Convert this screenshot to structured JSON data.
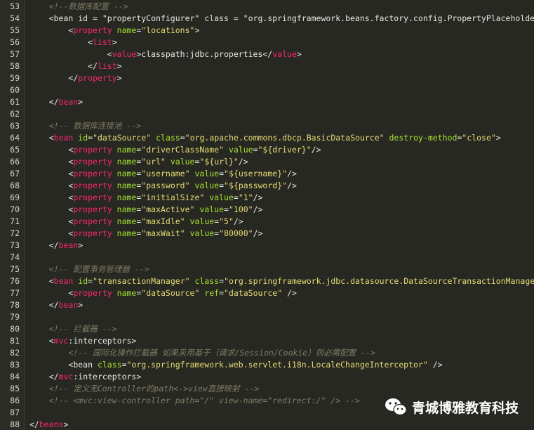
{
  "editor": {
    "lines": [
      {
        "n": "53",
        "tokens": [
          {
            "k": "ws",
            "v": "    "
          },
          {
            "k": "cmt",
            "v": "<!--数据库配置 -->"
          }
        ]
      },
      {
        "n": "54",
        "tokens": [
          {
            "k": "ws",
            "v": "    "
          },
          {
            "k": "punc",
            "v": "<bean id = "
          },
          {
            "k": "t",
            "v": "\"propertyConfigurer\""
          },
          {
            "k": "punc",
            "v": " class = "
          },
          {
            "k": "t",
            "v": "\"org.springframework.beans.factory.config.PropertyPlaceholderCon"
          }
        ]
      },
      {
        "n": "55",
        "tokens": [
          {
            "k": "ws",
            "v": "        "
          },
          {
            "k": "punc",
            "v": "<"
          },
          {
            "k": "tag",
            "v": "property"
          },
          {
            "k": "punc",
            "v": " "
          },
          {
            "k": "attr",
            "v": "name"
          },
          {
            "k": "punc",
            "v": "="
          },
          {
            "k": "str",
            "v": "\"locations\""
          },
          {
            "k": "punc",
            "v": ">"
          }
        ]
      },
      {
        "n": "56",
        "tokens": [
          {
            "k": "ws",
            "v": "            "
          },
          {
            "k": "punc",
            "v": "<"
          },
          {
            "k": "tag",
            "v": "list"
          },
          {
            "k": "punc",
            "v": ">"
          }
        ]
      },
      {
        "n": "57",
        "tokens": [
          {
            "k": "ws",
            "v": "                "
          },
          {
            "k": "punc",
            "v": "<"
          },
          {
            "k": "tag",
            "v": "value"
          },
          {
            "k": "punc",
            "v": ">"
          },
          {
            "k": "t",
            "v": "classpath:jdbc.properties"
          },
          {
            "k": "punc",
            "v": "</"
          },
          {
            "k": "tag",
            "v": "value"
          },
          {
            "k": "punc",
            "v": ">"
          }
        ]
      },
      {
        "n": "58",
        "tokens": [
          {
            "k": "ws",
            "v": "            "
          },
          {
            "k": "punc",
            "v": "</"
          },
          {
            "k": "tag",
            "v": "list"
          },
          {
            "k": "punc",
            "v": ">"
          }
        ]
      },
      {
        "n": "59",
        "tokens": [
          {
            "k": "ws",
            "v": "        "
          },
          {
            "k": "punc",
            "v": "</"
          },
          {
            "k": "tag",
            "v": "property"
          },
          {
            "k": "punc",
            "v": ">"
          }
        ]
      },
      {
        "n": "60",
        "tokens": []
      },
      {
        "n": "61",
        "tokens": [
          {
            "k": "ws",
            "v": "    "
          },
          {
            "k": "punc",
            "v": "</"
          },
          {
            "k": "tag",
            "v": "bean"
          },
          {
            "k": "punc",
            "v": ">"
          }
        ]
      },
      {
        "n": "62",
        "tokens": []
      },
      {
        "n": "63",
        "tokens": [
          {
            "k": "ws",
            "v": "    "
          },
          {
            "k": "cmt",
            "v": "<!-- 数据库连接池 -->"
          }
        ]
      },
      {
        "n": "64",
        "tokens": [
          {
            "k": "ws",
            "v": "    "
          },
          {
            "k": "punc",
            "v": "<"
          },
          {
            "k": "tag",
            "v": "bean"
          },
          {
            "k": "punc",
            "v": " "
          },
          {
            "k": "attr",
            "v": "id"
          },
          {
            "k": "punc",
            "v": "="
          },
          {
            "k": "str",
            "v": "\"dataSource\""
          },
          {
            "k": "punc",
            "v": " "
          },
          {
            "k": "attr",
            "v": "class"
          },
          {
            "k": "punc",
            "v": "="
          },
          {
            "k": "str",
            "v": "\"org.apache.commons.dbcp.BasicDataSource\""
          },
          {
            "k": "punc",
            "v": " "
          },
          {
            "k": "attr",
            "v": "destroy-method"
          },
          {
            "k": "punc",
            "v": "="
          },
          {
            "k": "str",
            "v": "\"close\""
          },
          {
            "k": "punc",
            "v": ">"
          }
        ]
      },
      {
        "n": "65",
        "tokens": [
          {
            "k": "ws",
            "v": "        "
          },
          {
            "k": "punc",
            "v": "<"
          },
          {
            "k": "tag",
            "v": "property"
          },
          {
            "k": "punc",
            "v": " "
          },
          {
            "k": "attr",
            "v": "name"
          },
          {
            "k": "punc",
            "v": "="
          },
          {
            "k": "str",
            "v": "\"driverClassName\""
          },
          {
            "k": "punc",
            "v": " "
          },
          {
            "k": "attr",
            "v": "value"
          },
          {
            "k": "punc",
            "v": "="
          },
          {
            "k": "str",
            "v": "\"${driver}\""
          },
          {
            "k": "punc",
            "v": "/>"
          }
        ]
      },
      {
        "n": "66",
        "tokens": [
          {
            "k": "ws",
            "v": "        "
          },
          {
            "k": "punc",
            "v": "<"
          },
          {
            "k": "tag",
            "v": "property"
          },
          {
            "k": "punc",
            "v": " "
          },
          {
            "k": "attr",
            "v": "name"
          },
          {
            "k": "punc",
            "v": "="
          },
          {
            "k": "str",
            "v": "\"url\""
          },
          {
            "k": "punc",
            "v": " "
          },
          {
            "k": "attr",
            "v": "value"
          },
          {
            "k": "punc",
            "v": "="
          },
          {
            "k": "str",
            "v": "\"${url}\""
          },
          {
            "k": "punc",
            "v": "/>"
          }
        ]
      },
      {
        "n": "67",
        "tokens": [
          {
            "k": "ws",
            "v": "        "
          },
          {
            "k": "punc",
            "v": "<"
          },
          {
            "k": "tag",
            "v": "property"
          },
          {
            "k": "punc",
            "v": " "
          },
          {
            "k": "attr",
            "v": "name"
          },
          {
            "k": "punc",
            "v": "="
          },
          {
            "k": "str",
            "v": "\"username\""
          },
          {
            "k": "punc",
            "v": " "
          },
          {
            "k": "attr",
            "v": "value"
          },
          {
            "k": "punc",
            "v": "="
          },
          {
            "k": "str",
            "v": "\"${username}\""
          },
          {
            "k": "punc",
            "v": "/>"
          }
        ]
      },
      {
        "n": "68",
        "tokens": [
          {
            "k": "ws",
            "v": "        "
          },
          {
            "k": "punc",
            "v": "<"
          },
          {
            "k": "tag",
            "v": "property"
          },
          {
            "k": "punc",
            "v": " "
          },
          {
            "k": "attr",
            "v": "name"
          },
          {
            "k": "punc",
            "v": "="
          },
          {
            "k": "str",
            "v": "\"password\""
          },
          {
            "k": "punc",
            "v": " "
          },
          {
            "k": "attr",
            "v": "value"
          },
          {
            "k": "punc",
            "v": "="
          },
          {
            "k": "str",
            "v": "\"${password}\""
          },
          {
            "k": "punc",
            "v": "/>"
          }
        ]
      },
      {
        "n": "69",
        "tokens": [
          {
            "k": "ws",
            "v": "        "
          },
          {
            "k": "punc",
            "v": "<"
          },
          {
            "k": "tag",
            "v": "property"
          },
          {
            "k": "punc",
            "v": " "
          },
          {
            "k": "attr",
            "v": "name"
          },
          {
            "k": "punc",
            "v": "="
          },
          {
            "k": "str",
            "v": "\"initialSize\""
          },
          {
            "k": "punc",
            "v": " "
          },
          {
            "k": "attr",
            "v": "value"
          },
          {
            "k": "punc",
            "v": "="
          },
          {
            "k": "str",
            "v": "\"1\""
          },
          {
            "k": "punc",
            "v": "/>"
          }
        ]
      },
      {
        "n": "70",
        "tokens": [
          {
            "k": "ws",
            "v": "        "
          },
          {
            "k": "punc",
            "v": "<"
          },
          {
            "k": "tag",
            "v": "property"
          },
          {
            "k": "punc",
            "v": " "
          },
          {
            "k": "attr",
            "v": "name"
          },
          {
            "k": "punc",
            "v": "="
          },
          {
            "k": "str",
            "v": "\"maxActive\""
          },
          {
            "k": "punc",
            "v": " "
          },
          {
            "k": "attr",
            "v": "value"
          },
          {
            "k": "punc",
            "v": "="
          },
          {
            "k": "str",
            "v": "\"100\""
          },
          {
            "k": "punc",
            "v": "/>"
          }
        ]
      },
      {
        "n": "71",
        "tokens": [
          {
            "k": "ws",
            "v": "        "
          },
          {
            "k": "punc",
            "v": "<"
          },
          {
            "k": "tag",
            "v": "property"
          },
          {
            "k": "punc",
            "v": " "
          },
          {
            "k": "attr",
            "v": "name"
          },
          {
            "k": "punc",
            "v": "="
          },
          {
            "k": "str",
            "v": "\"maxIdle\""
          },
          {
            "k": "punc",
            "v": " "
          },
          {
            "k": "attr",
            "v": "value"
          },
          {
            "k": "punc",
            "v": "="
          },
          {
            "k": "str",
            "v": "\"5\""
          },
          {
            "k": "punc",
            "v": "/>"
          }
        ]
      },
      {
        "n": "72",
        "tokens": [
          {
            "k": "ws",
            "v": "        "
          },
          {
            "k": "punc",
            "v": "<"
          },
          {
            "k": "tag",
            "v": "property"
          },
          {
            "k": "punc",
            "v": " "
          },
          {
            "k": "attr",
            "v": "name"
          },
          {
            "k": "punc",
            "v": "="
          },
          {
            "k": "str",
            "v": "\"maxWait\""
          },
          {
            "k": "punc",
            "v": " "
          },
          {
            "k": "attr",
            "v": "value"
          },
          {
            "k": "punc",
            "v": "="
          },
          {
            "k": "str",
            "v": "\"80000\""
          },
          {
            "k": "punc",
            "v": "/>"
          }
        ]
      },
      {
        "n": "73",
        "tokens": [
          {
            "k": "ws",
            "v": "    "
          },
          {
            "k": "punc",
            "v": "</"
          },
          {
            "k": "tag",
            "v": "bean"
          },
          {
            "k": "punc",
            "v": ">"
          }
        ]
      },
      {
        "n": "74",
        "tokens": []
      },
      {
        "n": "75",
        "tokens": [
          {
            "k": "ws",
            "v": "    "
          },
          {
            "k": "cmt",
            "v": "<!-- 配置事务管理器 -->"
          }
        ]
      },
      {
        "n": "76",
        "tokens": [
          {
            "k": "ws",
            "v": "    "
          },
          {
            "k": "punc",
            "v": "<"
          },
          {
            "k": "tag",
            "v": "bean"
          },
          {
            "k": "punc",
            "v": " "
          },
          {
            "k": "attr",
            "v": "id"
          },
          {
            "k": "punc",
            "v": "="
          },
          {
            "k": "str",
            "v": "\"transactionManager\""
          },
          {
            "k": "punc",
            "v": " "
          },
          {
            "k": "attr",
            "v": "class"
          },
          {
            "k": "punc",
            "v": "="
          },
          {
            "k": "str",
            "v": "\"org.springframework.jdbc.datasource.DataSourceTransactionManager\""
          },
          {
            "k": "punc",
            "v": ">"
          }
        ]
      },
      {
        "n": "77",
        "tokens": [
          {
            "k": "ws",
            "v": "        "
          },
          {
            "k": "punc",
            "v": "<"
          },
          {
            "k": "tag",
            "v": "property"
          },
          {
            "k": "punc",
            "v": " "
          },
          {
            "k": "attr",
            "v": "name"
          },
          {
            "k": "punc",
            "v": "="
          },
          {
            "k": "str",
            "v": "\"dataSource\""
          },
          {
            "k": "punc",
            "v": " "
          },
          {
            "k": "attr",
            "v": "ref"
          },
          {
            "k": "punc",
            "v": "="
          },
          {
            "k": "str",
            "v": "\"dataSource\""
          },
          {
            "k": "punc",
            "v": " />"
          }
        ]
      },
      {
        "n": "78",
        "tokens": [
          {
            "k": "ws",
            "v": "    "
          },
          {
            "k": "punc",
            "v": "</"
          },
          {
            "k": "tag",
            "v": "bean"
          },
          {
            "k": "punc",
            "v": ">"
          }
        ]
      },
      {
        "n": "79",
        "tokens": []
      },
      {
        "n": "80",
        "tokens": [
          {
            "k": "ws",
            "v": "    "
          },
          {
            "k": "cmt",
            "v": "<!-- 拦截器 -->"
          }
        ]
      },
      {
        "n": "81",
        "tokens": [
          {
            "k": "ws",
            "v": "    "
          },
          {
            "k": "punc",
            "v": "<"
          },
          {
            "k": "tag",
            "v": "mvc"
          },
          {
            "k": "punc",
            "v": ":interceptors>"
          }
        ]
      },
      {
        "n": "82",
        "tokens": [
          {
            "k": "ws",
            "v": "        "
          },
          {
            "k": "cmt",
            "v": "<!-- 国际化操作拦截器 如果采用基于（请求/Session/Cookie）则必需配置 -->"
          }
        ]
      },
      {
        "n": "83",
        "tokens": [
          {
            "k": "ws",
            "v": "        "
          },
          {
            "k": "punc",
            "v": "<bean "
          },
          {
            "k": "attr",
            "v": "class"
          },
          {
            "k": "punc",
            "v": "="
          },
          {
            "k": "str",
            "v": "\"org.springframework.web.servlet.i18n.LocaleChangeInterceptor\""
          },
          {
            "k": "punc",
            "v": " />"
          }
        ]
      },
      {
        "n": "84",
        "tokens": [
          {
            "k": "ws",
            "v": "    "
          },
          {
            "k": "punc",
            "v": "</"
          },
          {
            "k": "tag",
            "v": "mvc"
          },
          {
            "k": "punc",
            "v": ":interceptors>"
          }
        ]
      },
      {
        "n": "85",
        "tokens": [
          {
            "k": "ws",
            "v": "    "
          },
          {
            "k": "cmt",
            "v": "<!-- 定义无Controller的path<->view直接映射 -->"
          }
        ]
      },
      {
        "n": "86",
        "tokens": [
          {
            "k": "ws",
            "v": "    "
          },
          {
            "k": "cmt",
            "v": "<!-- <mvc:view-controller path=\"/\" view-name=\"redirect:/\" /> -->"
          }
        ]
      },
      {
        "n": "87",
        "tokens": []
      },
      {
        "n": "88",
        "tokens": [
          {
            "k": "punc",
            "v": "</"
          },
          {
            "k": "tag",
            "v": "beans"
          },
          {
            "k": "punc",
            "v": ">"
          }
        ]
      }
    ]
  },
  "watermark": {
    "text": "青城博雅教育科技",
    "icon": "wechat-icon"
  },
  "colors": {
    "background": "#272822",
    "tag": "#f92672",
    "attribute": "#a6e22e",
    "string": "#e6db74",
    "comment": "#7f7a65",
    "text": "#e8e8e2"
  }
}
